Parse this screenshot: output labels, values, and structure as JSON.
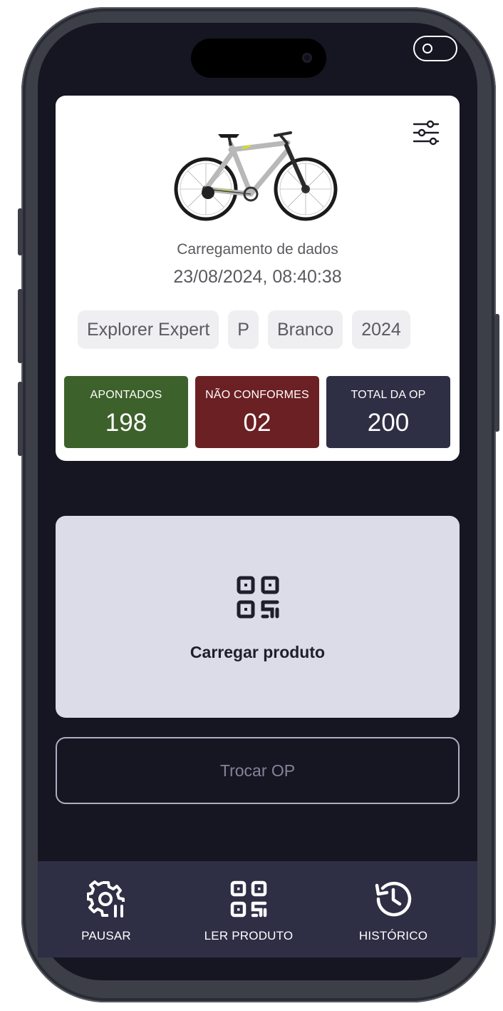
{
  "header": {
    "title": "Carregamento de dados",
    "datetime": "23/08/2024, 08:40:38"
  },
  "product": {
    "chips": [
      "Explorer Expert",
      "P",
      "Branco",
      "2024"
    ]
  },
  "stats": [
    {
      "label": "APONTADOS",
      "value": "198",
      "color": "#3d612b"
    },
    {
      "label": "NÃO CONFORMES",
      "value": "02",
      "color": "#6b2023"
    },
    {
      "label": "TOTAL DA OP",
      "value": "200",
      "color": "#2e2e45"
    }
  ],
  "actions": {
    "load_product": "Carregar produto",
    "switch_op": "Trocar OP"
  },
  "bottom_nav": {
    "items": [
      {
        "label": "PAUSAR",
        "icon": "settings-pause-icon"
      },
      {
        "label": "LER PRODUTO",
        "icon": "qr-code-icon"
      },
      {
        "label": "HISTÓRICO",
        "icon": "history-icon"
      }
    ]
  },
  "colors": {
    "background": "#161622",
    "card": "#ffffff",
    "load_card": "#dcdce8",
    "nav": "#2e2e45"
  }
}
